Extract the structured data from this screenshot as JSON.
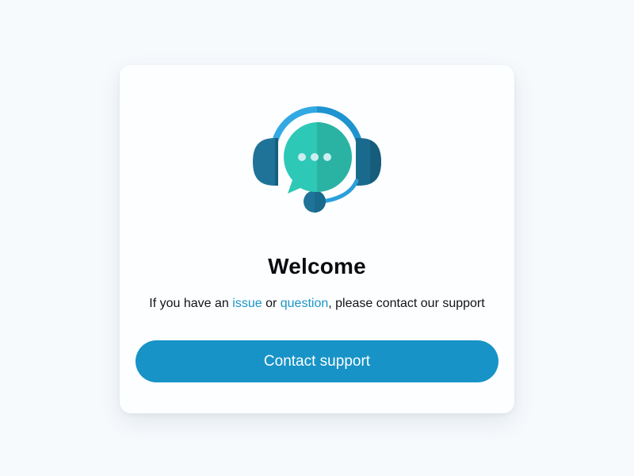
{
  "card": {
    "illustration_icon": "support-headset-chat-icon",
    "title": "Welcome",
    "message": {
      "prefix": "If you have an ",
      "issue_link": "issue",
      "middle": " or ",
      "question_link": "question",
      "suffix": ", please contact our support"
    },
    "button_label": "Contact support"
  },
  "colors": {
    "page_background": "#f7fafd",
    "card_background": "#fcfeff",
    "accent": "#1793c7",
    "link": "#1b95c7",
    "headset_dark": "#186c8e",
    "headset_ring": "#28a0dc",
    "chat_bubble": "#2cc4b4",
    "title_text": "#0b0c10"
  }
}
